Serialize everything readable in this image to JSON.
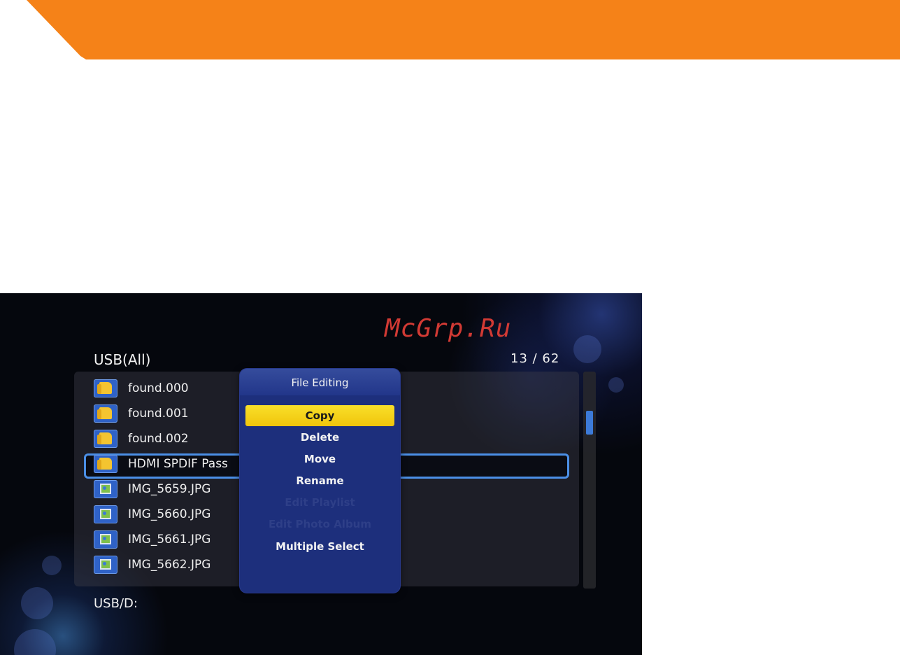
{
  "screen": {
    "header_title": "USB(All)",
    "counter": "13 / 62",
    "path": "USB/D:",
    "watermark": "McGrp.Ru"
  },
  "file_list": [
    {
      "name": "found.000",
      "icon": "folder-icon"
    },
    {
      "name": "found.001",
      "icon": "folder-icon"
    },
    {
      "name": "found.002",
      "icon": "folder-icon"
    },
    {
      "name": "HDMI SPDIF Pass",
      "icon": "folder-icon",
      "selected": true
    },
    {
      "name": "IMG_5659.JPG",
      "icon": "photo-icon"
    },
    {
      "name": "IMG_5660.JPG",
      "icon": "photo-icon"
    },
    {
      "name": "IMG_5661.JPG",
      "icon": "photo-icon"
    },
    {
      "name": "IMG_5662.JPG",
      "icon": "photo-icon"
    }
  ],
  "popup": {
    "title": "File Editing",
    "items": [
      {
        "label": "Copy",
        "state": "highlighted"
      },
      {
        "label": "Delete",
        "state": "enabled"
      },
      {
        "label": "Move",
        "state": "enabled"
      },
      {
        "label": "Rename",
        "state": "enabled"
      },
      {
        "label": "Edit Playlist",
        "state": "disabled"
      },
      {
        "label": "Edit Photo Album",
        "state": "disabled"
      },
      {
        "label": "Multiple Select",
        "state": "enabled"
      }
    ]
  },
  "colors": {
    "banner": "#f58218",
    "highlight": "#f4d21a",
    "selection_border": "#4b8fe6",
    "popup_bg": "#1d2f7c"
  }
}
